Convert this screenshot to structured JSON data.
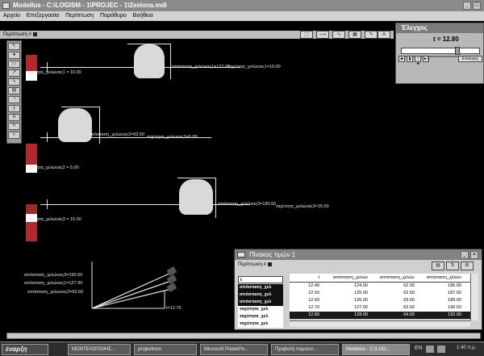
{
  "window": {
    "title": "Modellus - C:\\LOGISM - 1\\PROJEC - 1\\2xelona.mdl",
    "min": "_",
    "max": "□"
  },
  "menu": [
    "Αρχείο",
    "Επεξεργασία",
    "Περίπτωση",
    "Παράθυρο",
    "Βοήθεια"
  ],
  "panel": {
    "title": "Περίπτωση #"
  },
  "control": {
    "title": "Έλεγχος",
    "time_label": "t = 12.80",
    "buttons": [
      "■",
      "▮",
      "|◄",
      "►|",
      "Επιλογές"
    ]
  },
  "animation": {
    "turtle1": {
      "label": "ταχύτητα_χελώνας1 = 10.00",
      "pos_label": "απόσταση_χελώνας1=127.00",
      "speed_label": "ταχύτητα_χελώνας1=10.00"
    },
    "turtle2": {
      "label": "ταχύτητα_χελώνας2 = 5.00",
      "pos_label": "απόσταση_χελώνας2=63.50",
      "speed_label": "ταχύτητα_χελώνας2=5.00"
    },
    "turtle3": {
      "label": "ταχύτητα_χελώνας3 = 15.00",
      "pos_label": "απόσταση_χελώνας3=190.50",
      "speed_label": "ταχύτητα_χελώνας3=15.00"
    },
    "graph": {
      "labels": [
        "απόσταση_χελώνας3=190.50",
        "απόσταση_χελώνας1=127.00",
        "απόσταση_χελώνας2=63.50"
      ],
      "t_label": "t=12.70"
    }
  },
  "table": {
    "title": "Πίνακας τιμών 1",
    "case": "Περίπτωση #",
    "headers": [
      "t",
      "απόσταση_χελών",
      "απόσταση_χελών",
      "απόσταση_χελών"
    ],
    "rows": [
      [
        "12.40",
        "124.00",
        "62.00",
        "186.00"
      ],
      [
        "12.50",
        "125.00",
        "62.50",
        "187.50"
      ],
      [
        "12.60",
        "126.00",
        "63.00",
        "189.00"
      ],
      [
        "12.70",
        "127.00",
        "63.50",
        "190.50"
      ],
      [
        "12.80",
        "128.00",
        "64.00",
        "192.00"
      ]
    ],
    "var_list": [
      "t",
      "απόσταση_χελ",
      "απόσταση_χελ",
      "απόσταση_χελ",
      "ταχύτητα_χελ",
      "ταχύτητα_χελ",
      "ταχύτητα_χελ"
    ]
  },
  "taskbar": {
    "start": "έναρξη",
    "items": [
      "ΜΟΝΤΕΛΟΠΟΙΗΣ...",
      "projections",
      "Microsoft PowerPo...",
      "Προβολή παρουσ...",
      "Modellus - C:\\LOG..."
    ],
    "lang": "EN",
    "clock": "1:40 π.μ."
  },
  "colors": {
    "bar_red": "#b0292b",
    "bar_white": "#ffffff",
    "titlebar": "#8a8a8a"
  }
}
